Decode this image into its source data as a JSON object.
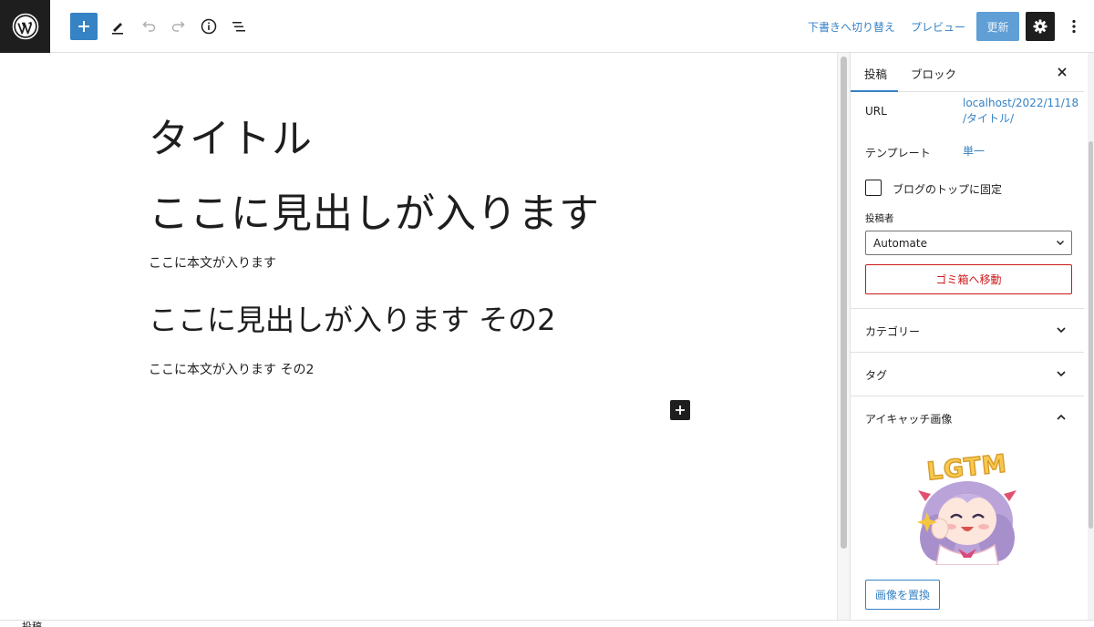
{
  "toolbar": {
    "switch_draft": "下書きへ切り替え",
    "preview": "プレビュー",
    "update": "更新"
  },
  "content": {
    "title": "タイトル",
    "heading1": "ここに見出しが入ります",
    "paragraph1": "ここに本文が入ります",
    "heading2": "ここに見出しが入ります その2",
    "paragraph2": "ここに本文が入ります その2"
  },
  "sidebar": {
    "tabs": [
      {
        "label": "投稿",
        "active": true
      },
      {
        "label": "ブロック",
        "active": false
      }
    ],
    "url_label": "URL",
    "url_value_line1": "localhost/2022/11/18",
    "url_value_line2": "/タイトル/",
    "template_label": "テンプレート",
    "template_value": "単一",
    "sticky_label": "ブログのトップに固定",
    "sticky_checked": false,
    "author_label": "投稿者",
    "author_value": "Automate",
    "trash_label": "ゴミ箱へ移動",
    "panels": [
      {
        "label": "カテゴリー",
        "open": false
      },
      {
        "label": "タグ",
        "open": false
      },
      {
        "label": "アイキャッチ画像",
        "open": true
      }
    ],
    "featured_image_text": "LGTM",
    "replace_image": "画像を置換"
  },
  "footer": {
    "breadcrumb": "投稿"
  },
  "colors": {
    "accent": "#3582c4",
    "danger": "#cc1818",
    "dark": "#1e1e1e"
  }
}
